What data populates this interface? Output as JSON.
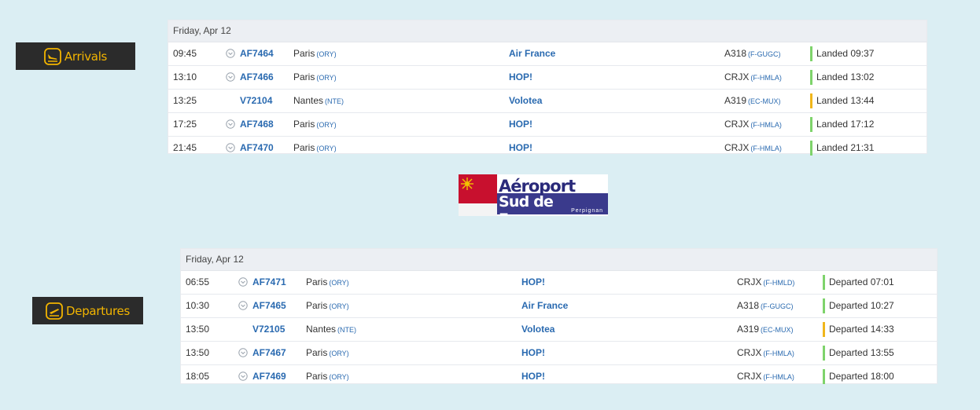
{
  "arrivals": {
    "button_label": "Arrivals",
    "date": "Friday, Apr 12",
    "rows": [
      {
        "time": "09:45",
        "chevron": true,
        "flight": "AF7464",
        "city": "Paris",
        "code": "(ORY)",
        "airline": "Air France",
        "aircraft": "A318",
        "reg": "(F-GUGC)",
        "status_color": "#7ed36b",
        "status": "Landed 09:37"
      },
      {
        "time": "13:10",
        "chevron": true,
        "flight": "AF7466",
        "city": "Paris",
        "code": "(ORY)",
        "airline": "HOP!",
        "aircraft": "CRJX",
        "reg": "(F-HMLA)",
        "status_color": "#7ed36b",
        "status": "Landed 13:02"
      },
      {
        "time": "13:25",
        "chevron": false,
        "flight": "V72104",
        "city": "Nantes",
        "code": "(NTE)",
        "airline": "Volotea",
        "aircraft": "A319",
        "reg": "(EC-MUX)",
        "status_color": "#f0b61b",
        "status": "Landed 13:44"
      },
      {
        "time": "17:25",
        "chevron": true,
        "flight": "AF7468",
        "city": "Paris",
        "code": "(ORY)",
        "airline": "HOP!",
        "aircraft": "CRJX",
        "reg": "(F-HMLA)",
        "status_color": "#7ed36b",
        "status": "Landed 17:12"
      },
      {
        "time": "21:45",
        "chevron": true,
        "flight": "AF7470",
        "city": "Paris",
        "code": "(ORY)",
        "airline": "HOP!",
        "aircraft": "CRJX",
        "reg": "(F-HMLA)",
        "status_color": "#7ed36b",
        "status": "Landed 21:31"
      }
    ]
  },
  "departures": {
    "button_label": "Departures",
    "date": "Friday, Apr 12",
    "rows": [
      {
        "time": "06:55",
        "chevron": true,
        "flight": "AF7471",
        "city": "Paris",
        "code": "(ORY)",
        "airline": "HOP!",
        "aircraft": "CRJX",
        "reg": "(F-HMLD)",
        "status_color": "#7ed36b",
        "status": "Departed 07:01"
      },
      {
        "time": "10:30",
        "chevron": true,
        "flight": "AF7465",
        "city": "Paris",
        "code": "(ORY)",
        "airline": "Air France",
        "aircraft": "A318",
        "reg": "(F-GUGC)",
        "status_color": "#7ed36b",
        "status": "Departed 10:27"
      },
      {
        "time": "13:50",
        "chevron": false,
        "flight": "V72105",
        "city": "Nantes",
        "code": "(NTE)",
        "airline": "Volotea",
        "aircraft": "A319",
        "reg": "(EC-MUX)",
        "status_color": "#f0b61b",
        "status": "Departed 14:33"
      },
      {
        "time": "13:50",
        "chevron": true,
        "flight": "AF7467",
        "city": "Paris",
        "code": "(ORY)",
        "airline": "HOP!",
        "aircraft": "CRJX",
        "reg": "(F-HMLA)",
        "status_color": "#7ed36b",
        "status": "Departed 13:55"
      },
      {
        "time": "18:05",
        "chevron": true,
        "flight": "AF7469",
        "city": "Paris",
        "code": "(ORY)",
        "airline": "HOP!",
        "aircraft": "CRJX",
        "reg": "(F-HMLA)",
        "status_color": "#7ed36b",
        "status": "Departed 18:00"
      }
    ]
  },
  "logo": {
    "line1": "Aéroport",
    "line2": "Sud de France",
    "line3": "Perpignan"
  },
  "colors": {
    "background": "#dbeef3",
    "button_bg": "#2b2b2b",
    "button_text": "#f2b400",
    "link_blue": "#2a6ab0",
    "status_green": "#7ed36b",
    "status_amber": "#f0b61b"
  },
  "icons": {
    "arrivals": "plane-landing-icon",
    "departures": "plane-takeoff-icon",
    "row_expand": "chevron-down-circle-icon"
  }
}
